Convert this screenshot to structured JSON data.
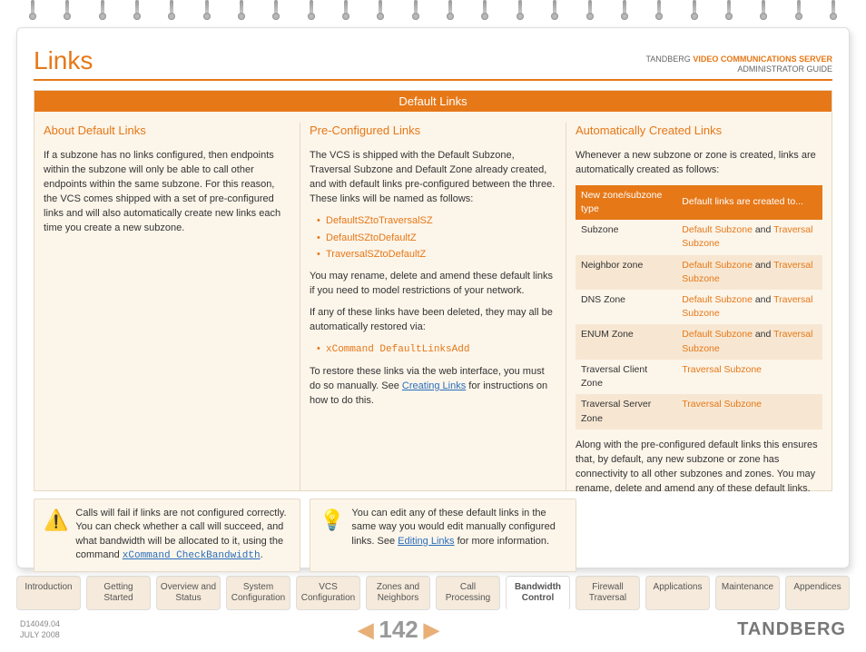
{
  "header": {
    "title": "Links",
    "brand_prefix": "TANDBERG",
    "brand_line1": "VIDEO COMMUNICATIONS SERVER",
    "brand_line2": "ADMINISTRATOR GUIDE"
  },
  "section_bar": "Default Links",
  "col1": {
    "heading": "About Default Links",
    "p1": "If a subzone has no links configured, then endpoints within the subzone will only be able to call other endpoints within the same subzone.  For this reason, the VCS comes shipped with a set of pre-configured links and will also automatically create new links each time you create a new subzone."
  },
  "col2": {
    "heading": "Pre-Configured Links",
    "p1": "The VCS is shipped with the Default Subzone, Traversal Subzone and Default Zone already created, and with default links pre-configured between the three.  These links will be named as follows:",
    "bullets": [
      "DefaultSZtoTraversalSZ",
      "DefaultSZtoDefaultZ",
      "TraversalSZtoDefaultZ"
    ],
    "p2": "You may rename, delete and amend these default links if you need to model restrictions of your network.",
    "p3": "If any of these links have been deleted, they may all be automatically restored via:",
    "cmd": "xCommand DefaultLinksAdd",
    "p4a": "To restore these links via the web interface, you must do so manually.  See ",
    "p4_link": "Creating Links",
    "p4b": " for instructions on how to do this."
  },
  "col3": {
    "heading": "Automatically Created Links",
    "p1": "Whenever a new subzone or zone is created, links are automatically created as follows:",
    "table": {
      "th1": "New zone/subzone type",
      "th2": "Default links are created to...",
      "rows": [
        {
          "c1": "Subzone",
          "links": [
            "Default Subzone",
            "Traversal Subzone"
          ],
          "joiner": " and "
        },
        {
          "c1": "Neighbor zone",
          "links": [
            "Default Subzone",
            "Traversal Subzone"
          ],
          "joiner": " and "
        },
        {
          "c1": "DNS Zone",
          "links": [
            "Default Subzone",
            "Traversal Subzone"
          ],
          "joiner": " and "
        },
        {
          "c1": "ENUM Zone",
          "links": [
            "Default Subzone",
            "Traversal Subzone"
          ],
          "joiner": " and "
        },
        {
          "c1": "Traversal Client Zone",
          "links": [
            "Traversal Subzone"
          ],
          "joiner": ""
        },
        {
          "c1": "Traversal Server Zone",
          "links": [
            "Traversal Subzone"
          ],
          "joiner": ""
        }
      ]
    },
    "p2": "Along with the pre-configured default links this ensures that, by default, any new subzone or zone has connectivity to all other subzones and zones.  You may rename, delete and amend any of these default links."
  },
  "note1": {
    "text_a": "Calls will fail if links are not configured correctly.  You can check whether a call will succeed, and what bandwidth will be allocated to it, using the command ",
    "cmd": "xCommand CheckBandwidth",
    "text_b": "."
  },
  "note2": {
    "text_a": "You can edit any of these default links in the same way you would edit manually configured links.  See ",
    "link": "Editing Links",
    "text_b": " for more information."
  },
  "tabs": [
    "Introduction",
    "Getting Started",
    "Overview and Status",
    "System Configuration",
    "VCS Configuration",
    "Zones and Neighbors",
    "Call Processing",
    "Bandwidth Control",
    "Firewall Traversal",
    "Applications",
    "Maintenance",
    "Appendices"
  ],
  "active_tab_index": 7,
  "footer": {
    "docid": "D14049.04",
    "date": "JULY 2008",
    "page": "142",
    "logo": "TANDBERG"
  }
}
